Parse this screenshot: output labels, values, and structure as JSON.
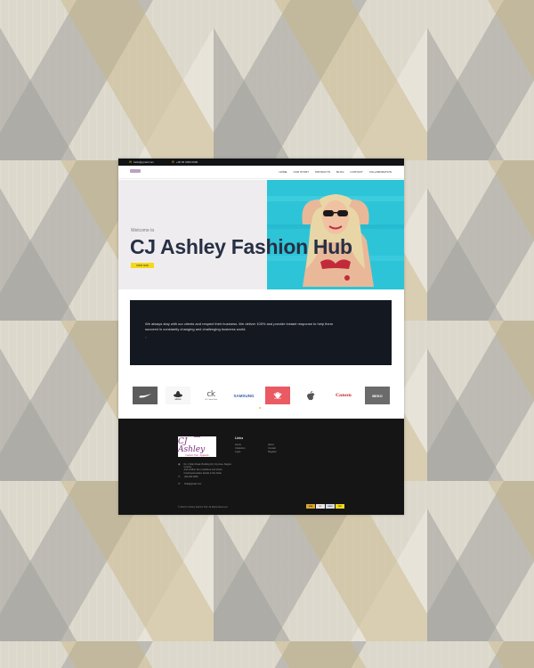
{
  "topbar": {
    "email": "hello@gmail.com",
    "phone": "+00 00 0000 0000"
  },
  "nav": {
    "items": [
      "Home",
      "Our Story",
      "Products",
      "Blog",
      "Contact",
      "Collaboration"
    ]
  },
  "hero": {
    "welcome": "Welcome to",
    "title": "CJ Ashley Fashion Hub",
    "button": "SHOP NOW"
  },
  "about": {
    "text": "We always stay with our clients and respect their business. We deliver 100% and provide instant response to help them succeed in constantly changing and challenging business world.",
    "quote_mark": "\""
  },
  "brands": [
    "Nike",
    "adidas",
    "CK Calvin Klein",
    "SAMSUNG",
    "HUAWEI",
    "Apple",
    "Canon",
    "BEKO"
  ],
  "footer": {
    "logo_main": "CJ Ashley",
    "logo_sub": "Fashion Hub · Apparels",
    "address": "No. 1 Main Road, Building 02, City Area, Region, Country\nAnd another line of address text shown\nContinued location details in this block",
    "phone": "(00) 000 0000",
    "email": "hello@gmail.com",
    "links_heading": "Links",
    "links_col1": [
      "Home",
      "Collection",
      "Login"
    ],
    "links_col2": [
      "About",
      "Contact",
      "Register"
    ],
    "copyright": "© 2024 CJ Ashley Fashion Hub. All Rights Reserved",
    "payments": [
      "VISA",
      "MC",
      "AMEX",
      "PAY"
    ]
  },
  "colors": {
    "accent": "#f5d916",
    "dark": "#141820",
    "hero_bg": "#efecef",
    "title": "#273044",
    "photo_bg": "#27c3d6"
  }
}
